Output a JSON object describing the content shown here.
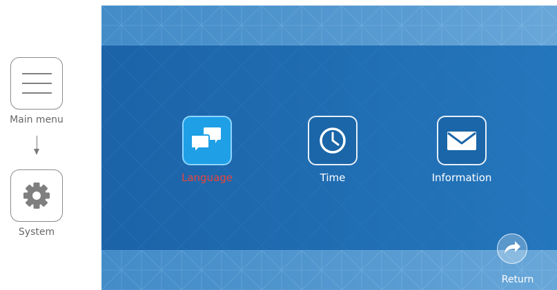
{
  "guide": {
    "main_menu_label": "Main menu",
    "system_label": "System",
    "main_menu_icon": "hamburger-menu-icon",
    "system_icon": "gear-icon"
  },
  "screen": {
    "items": [
      {
        "label": "Language",
        "icon": "chat-bubbles-icon",
        "selected": true
      },
      {
        "label": "Time",
        "icon": "clock-icon",
        "selected": false
      },
      {
        "label": "Information",
        "icon": "envelope-icon",
        "selected": false
      }
    ],
    "return_label": "Return",
    "return_icon": "return-arrow-icon"
  },
  "colors": {
    "screen_blue": "#1f6fb3",
    "selected_tile": "#1e9fe6",
    "selected_text": "#e8453c"
  }
}
